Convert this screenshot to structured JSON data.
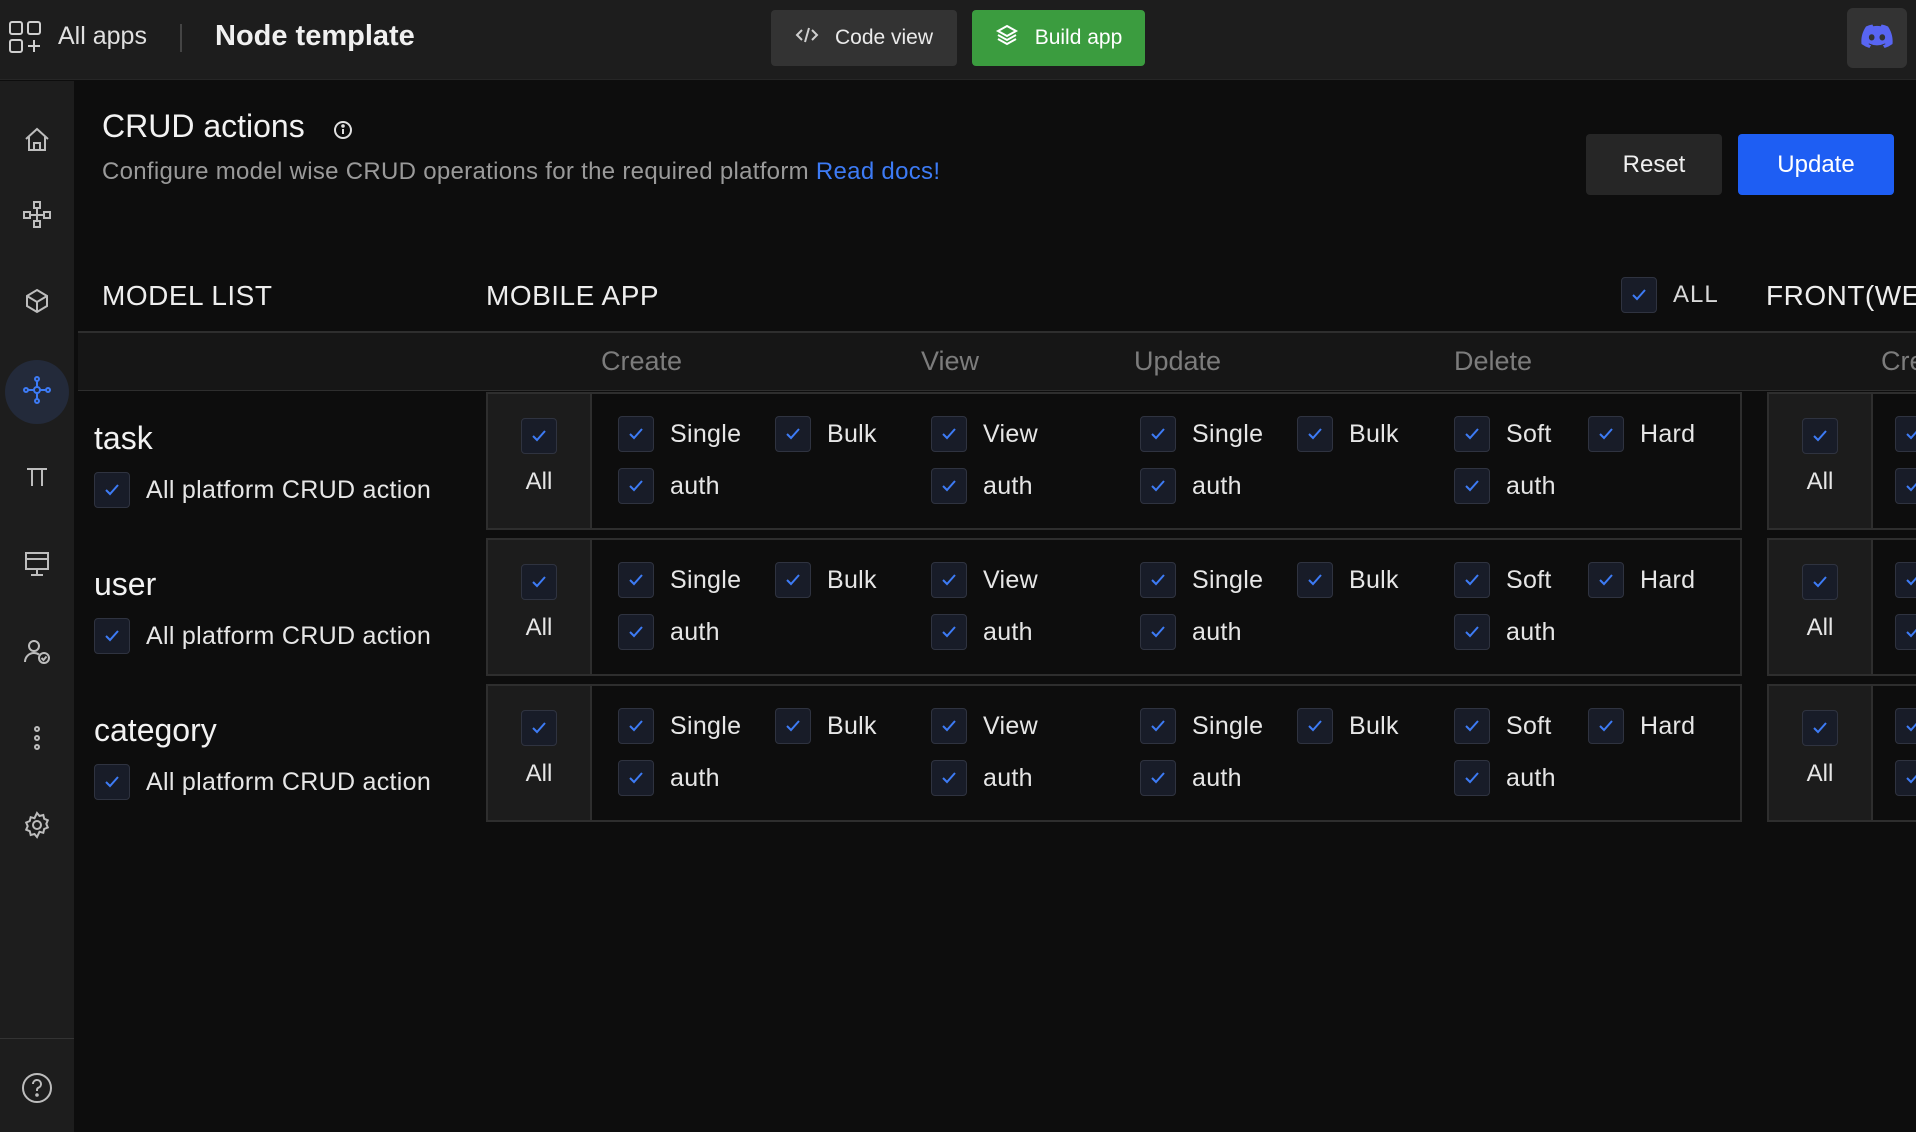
{
  "topbar": {
    "all_apps_label": "All apps",
    "app_title": "Node template",
    "code_view_label": "Code view",
    "build_app_label": "Build app"
  },
  "page": {
    "title": "CRUD actions",
    "description": "Configure model wise CRUD operations for the required platform",
    "docs_link": "Read docs!",
    "reset_label": "Reset",
    "update_label": "Update"
  },
  "sections": {
    "model_list": "MODEL LIST",
    "mobile_app": "MOBILE APP",
    "all_toggle": "ALL",
    "front_web": "FRONT(WE",
    "next_create_clip": "Cre"
  },
  "sub_headers": [
    "Create",
    "View",
    "Update",
    "Delete"
  ],
  "labels": {
    "all": "All",
    "all_platform": "All platform CRUD action",
    "single": "Single",
    "bulk": "Bulk",
    "view": "View",
    "soft": "Soft",
    "hard": "Hard",
    "auth": "auth"
  },
  "models": [
    {
      "name": "task"
    },
    {
      "name": "user"
    },
    {
      "name": "category"
    }
  ],
  "colors": {
    "accent": "#1e5ef3",
    "build": "#3b9c3f",
    "link": "#3d7bf5",
    "check": "#3d7bf5"
  }
}
